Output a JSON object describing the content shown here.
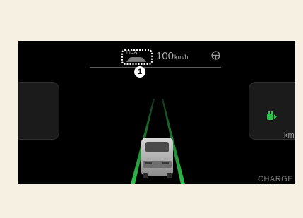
{
  "cluster": {
    "hda_label": "HDA",
    "speed_value": "100",
    "speed_unit": "km/h",
    "callout_number": "1",
    "right_panel_unit": "km",
    "bottom_right_label": "CHARGE"
  },
  "icons": [
    "car-icon",
    "steering-wheel-icon",
    "plug-icon"
  ],
  "colors": {
    "background": "#f6f0e2",
    "display": "#000000",
    "lane_line": "#27a845",
    "callout": "#ffffff",
    "plug_icon": "#2fbf4a"
  }
}
